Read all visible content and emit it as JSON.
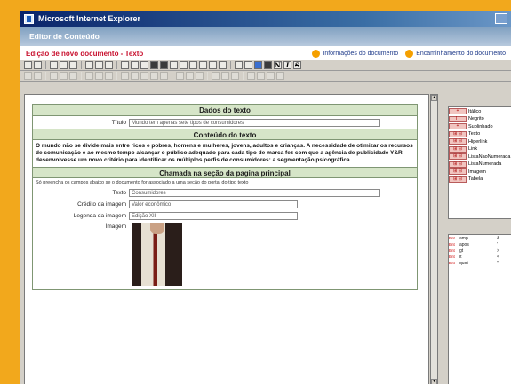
{
  "window": {
    "title": "Microsoft Internet Explorer"
  },
  "header": {
    "subtitle": "Editor de Conteúdo"
  },
  "docbar": {
    "title": "Edição de novo documento - Texto",
    "link_info": "Informações do documento",
    "link_route": "Encaminhamento do documento"
  },
  "sections": {
    "dados": "Dados do texto",
    "conteudo": "Conteúdo do texto",
    "chamada": "Chamada na seção da pagina principal"
  },
  "fields": {
    "titulo_label": "Título",
    "titulo_value": "Mundo tem apenas sete tipos de consumidores",
    "body": "O mundo não se divide mais entre ricos e pobres, homens e mulheres, jovens, adultos e crianças. A necessidade de otimizar os recursos de comunicação e ao mesmo tempo alcançar o público adequado para cada tipo de marca fez com que a agência de publicidade Y&R desenvolvesse um novo critério para identificar os múltiplos perfis de consumidores: a segmentação psicográfica.",
    "chamada_note": "Só preencha os campos abaixo se o documento for associado a uma seção do portal do tipo texto",
    "texto_label": "Texto",
    "texto_value": "Consumidores",
    "credito_label": "Crédito da imagem",
    "credito_value": "Valor econômico",
    "legenda_label": "Legenda da imagem",
    "legenda_value": "Edição XII",
    "imagem_label": "Imagem"
  },
  "tags": [
    {
      "icon": "+",
      "label": "Itálico"
    },
    {
      "icon": "I I",
      "label": "Negrito"
    },
    {
      "icon": "+",
      "label": "Sublinhado"
    },
    {
      "icon": "⊞ ⊟",
      "label": "Texto"
    },
    {
      "icon": "⊞ ⊟",
      "label": "Hiperlink"
    },
    {
      "icon": "⊞ ⊟",
      "label": "Link"
    },
    {
      "icon": "⊞ ⊟",
      "label": "ListaNaoNumerada"
    },
    {
      "icon": "⊞ ⊟",
      "label": "ListaNumerada"
    },
    {
      "icon": "⊞ ⊟",
      "label": "Imagem"
    },
    {
      "icon": "⊞ ⊟",
      "label": "Tabela"
    }
  ],
  "entities": [
    {
      "tag": "Ent",
      "name": "amp",
      "val": "&"
    },
    {
      "tag": "Ent",
      "name": "apos",
      "val": "'"
    },
    {
      "tag": "Ent",
      "name": "gt",
      "val": ">"
    },
    {
      "tag": "Ent",
      "name": "lt",
      "val": "<"
    },
    {
      "tag": "Ent",
      "name": "quot",
      "val": "\""
    }
  ],
  "toolbar": {
    "bold": "N",
    "italic": "I",
    "strike": "S"
  }
}
